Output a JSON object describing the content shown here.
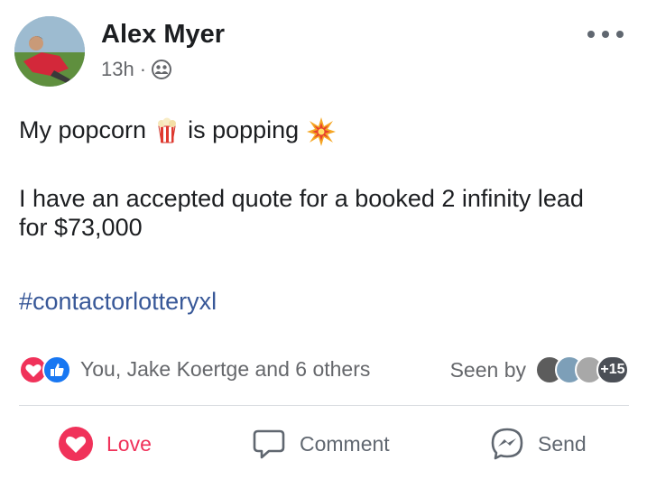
{
  "post": {
    "author": "Alex Myer",
    "time": "13h",
    "separator": "·",
    "privacy_icon": "friends-icon",
    "more_icon": "more-icon",
    "text_line1_a": "My popcorn",
    "text_line1_b": "is popping",
    "text_para2": "I have an accepted quote for a booked 2 infinity lead for $73,000",
    "hashtag": "#contactorlotteryxl"
  },
  "reactions": {
    "icons": [
      "love-reaction-icon",
      "like-reaction-icon"
    ],
    "summary": "You, Jake Koertge and 6 others",
    "seen_label": "Seen by",
    "seen_more": "+15"
  },
  "actions": {
    "love": "Love",
    "comment": "Comment",
    "send": "Send"
  },
  "colors": {
    "love": "#f0325a",
    "like": "#1877f2",
    "hashtag": "#385898",
    "secondary_text": "#65676b"
  }
}
